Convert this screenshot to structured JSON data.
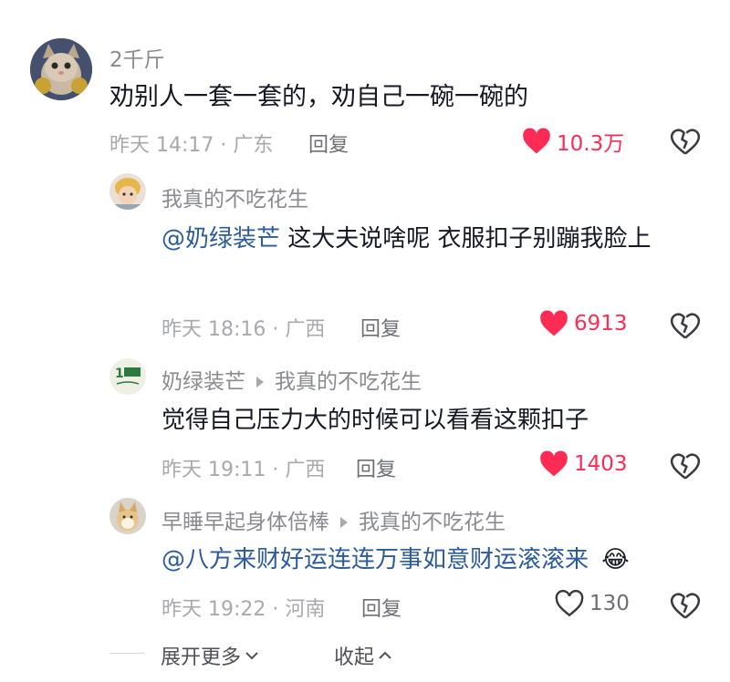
{
  "comments": [
    {
      "username": "2千斤",
      "text": "劝别人一套一套的，劝自己一碗一碗的",
      "time_location": "昨天 14:17 · 广东",
      "reply_label": "回复",
      "likes": "10.3万",
      "liked": true
    },
    {
      "username": "我真的不吃花生",
      "mention": "@奶绿装芒",
      "text": " 这大夫说啥呢 衣服扣子别蹦我脸上",
      "time_location": "昨天 18:16 · 广西",
      "reply_label": "回复",
      "likes": "6913",
      "liked": true
    },
    {
      "username": "奶绿装芒",
      "reply_to": "我真的不吃花生",
      "text": "觉得自己压力大的时候可以看看这颗扣子",
      "time_location": "昨天 19:11 · 广西",
      "reply_label": "回复",
      "likes": "1403",
      "liked": true
    },
    {
      "username": "早睡早起身体倍棒",
      "reply_to": "我真的不吃花生",
      "mention": "@八方来财好运连连万事如意财运滚滚来",
      "emoji": "😂",
      "time_location": "昨天 19:22 · 河南",
      "reply_label": "回复",
      "likes": "130",
      "liked": false
    }
  ],
  "footer": {
    "expand_more": "展开更多",
    "collapse": "收起"
  },
  "colors": {
    "like_active": "#fe2c55",
    "mention": "#2b5b9a",
    "meta": "#a8a9ad"
  }
}
